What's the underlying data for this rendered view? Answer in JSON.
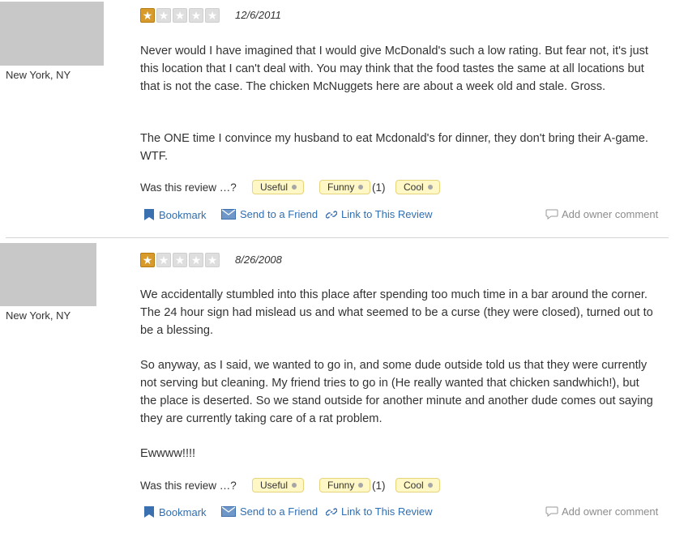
{
  "reviews": [
    {
      "location": "New York, NY",
      "rating": 1,
      "date": "12/6/2011",
      "paragraphs": [
        "Never would I have imagined that I would give McDonald's such a low rating.  But fear not, it's just this location that I can't deal with.  You may think that the food tastes the same at all locations but that is not the case.  The chicken McNuggets here are about a week old and stale.  Gross.",
        "The ONE time I convince my husband to eat Mcdonald's for dinner, they don't bring their A-game.  WTF."
      ],
      "feedback": {
        "prompt": "Was this review …?",
        "useful": "Useful",
        "funny": "Funny",
        "funny_count": "(1)",
        "cool": "Cool"
      },
      "actions": {
        "bookmark": "Bookmark",
        "send": "Send to a Friend",
        "link": "Link to This Review",
        "owner": "Add owner comment"
      }
    },
    {
      "location": "New York, NY",
      "rating": 1,
      "date": "8/26/2008",
      "paragraphs": [
        "We accidentally stumbled into this place after spending too much time in a bar around the corner. The 24 hour sign had mislead us and what seemed to be a curse (they were closed), turned out to be a blessing.",
        "So anyway, as I said, we wanted to go in, and some dude outside told us that they were currently not serving but cleaning. My friend tries to go in (He really wanted that chicken sandwhich!), but the place is deserted. So we stand outside for another minute and another dude comes out saying they are currently taking care of a rat problem.",
        "Ewwww!!!!"
      ],
      "feedback": {
        "prompt": "Was this review …?",
        "useful": "Useful",
        "funny": "Funny",
        "funny_count": "(1)",
        "cool": "Cool"
      },
      "actions": {
        "bookmark": "Bookmark",
        "send": "Send to a Friend",
        "link": "Link to This Review",
        "owner": "Add owner comment"
      }
    }
  ]
}
